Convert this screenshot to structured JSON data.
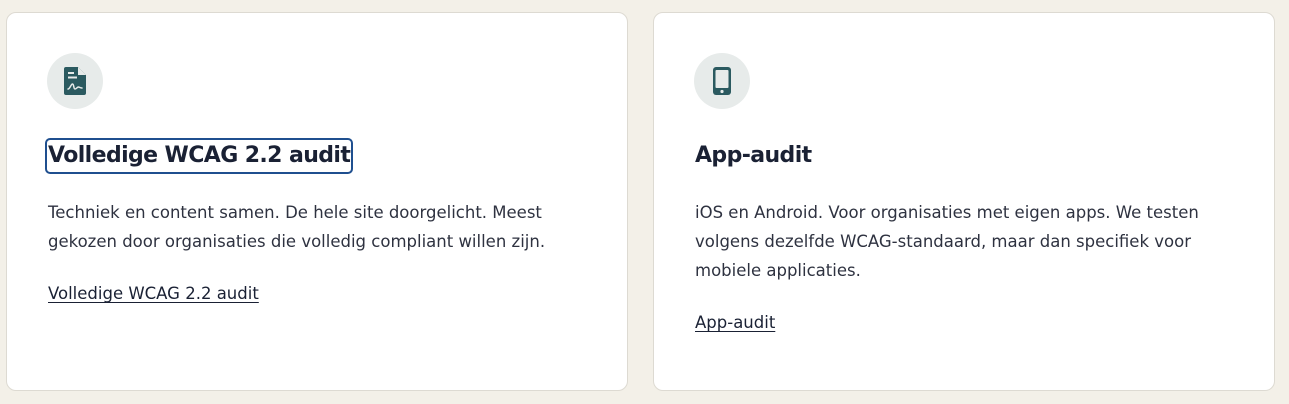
{
  "cards": [
    {
      "icon": "document-signature-icon",
      "title": "Volledige WCAG 2.2 audit",
      "description": "Techniek en content samen. De hele site doorgelicht. Meest gekozen door organisaties die volledig compliant willen zijn.",
      "link_label": "Volledige WCAG 2.2 audit"
    },
    {
      "icon": "smartphone-icon",
      "title": "App-audit",
      "description": "iOS en Android. Voor organisaties met eigen apps. We testen volgens dezelfde WCAG-standaard, maar dan specifiek voor mobiele applicaties.",
      "link_label": "App-audit"
    }
  ],
  "colors": {
    "page_background": "#f3f0e8",
    "card_background": "#ffffff",
    "icon_accent": "#2b5a60",
    "icon_circle": "#e7ebea",
    "title_text": "#1a2134",
    "focus_outline": "#1f4f8f"
  }
}
